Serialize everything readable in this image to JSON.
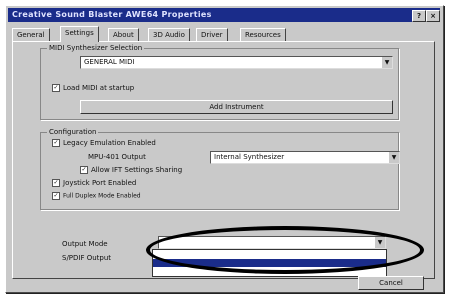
{
  "window": {
    "title": "Creative Sound Blaster AWE64 Properties",
    "help_glyph": "?",
    "close_glyph": "×"
  },
  "tabs": [
    {
      "label": "General"
    },
    {
      "label": "Settings"
    },
    {
      "label": "About"
    },
    {
      "label": "3D Audio"
    },
    {
      "label": "Driver"
    },
    {
      "label": "Resources"
    }
  ],
  "midi": {
    "legend": "MIDI Synthesizer Selection",
    "selected": "GENERAL MIDI",
    "checkbox_label": "Load MIDI at startup",
    "button_label": "Add Instrument"
  },
  "config": {
    "legend": "Configuration",
    "legacy_label": "Legacy Emulation Enabled",
    "mpu_label": "MPU-401 Output",
    "mpu_value": "Internal Synthesizer",
    "allow_label": "Allow IFT Settings Sharing",
    "joystick_label": "Joystick Port Enabled",
    "extra_label": "Full Duplex Mode Enabled"
  },
  "output": {
    "output_mode_label": "Output Mode",
    "spdif_label": "S/PDIF Output",
    "options": [
      "",
      "",
      "",
      ""
    ],
    "selected_index": 2
  },
  "footer": {
    "cancel_label": "Cancel"
  }
}
